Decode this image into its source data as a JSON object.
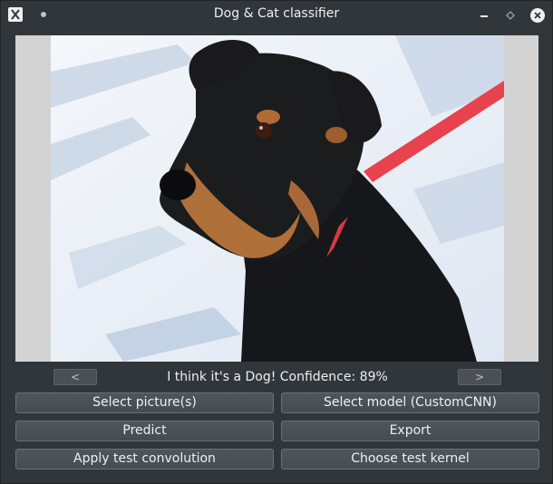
{
  "window": {
    "title": "Dog & Cat classifier"
  },
  "nav": {
    "prev_label": "<",
    "next_label": ">"
  },
  "status": {
    "text": "I think it's a Dog! Confidence: 89%"
  },
  "buttons": {
    "select_pictures": "Select picture(s)",
    "select_model": "Select model (CustomCNN)",
    "predict": "Predict",
    "export": "Export",
    "apply_convolution": "Apply test convolution",
    "choose_kernel": "Choose test kernel"
  },
  "icons": {
    "app": "x-app-icon",
    "pin": "pin-dot-icon",
    "minimize": "minimize-icon",
    "maximize": "maximize-icon",
    "close": "close-icon"
  },
  "colors": {
    "window_bg": "#31363b",
    "button_bg": "#4a5056",
    "text": "#eff0f1",
    "image_letterbox": "#d3d3d3"
  }
}
